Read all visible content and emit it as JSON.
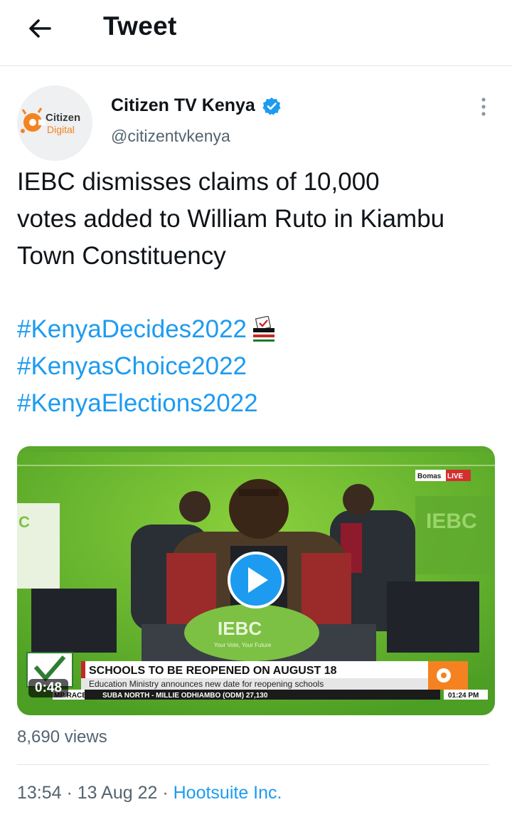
{
  "header": {
    "title": "Tweet",
    "back_icon": "arrow-left-icon"
  },
  "author": {
    "name": "Citizen TV Kenya",
    "handle": "@citizentvkenya",
    "verified": true,
    "avatar_logo_line1": "Citizen",
    "avatar_logo_line2": "Digital"
  },
  "tweet": {
    "text_lines": [
      "IEBC dismisses claims of 10,000",
      "votes added to William Ruto in Kiambu",
      "Town Constituency"
    ],
    "hashtags": [
      "#KenyaDecides2022",
      "#KenyasChoice2022",
      "#KenyaElections2022"
    ]
  },
  "video": {
    "duration": "0:48",
    "live_tag_brand": "Bomas",
    "live_tag_live": "LIVE",
    "podium_text": "IEBC",
    "podium_subtext": "Your Vote, Your Future",
    "backdrop_text": "IEBC",
    "headline": "SCHOOLS TO BE REOPENED ON AUGUST 18",
    "subheadline": "Education Ministry announces new date for reopening schools",
    "ticker_label": "MP RACE",
    "ticker_text": "SUBA NORTH - MILLIE ODHIAMBO (ODM) 27,130",
    "clock": "01:24 PM"
  },
  "stats": {
    "views": "8,690 views"
  },
  "meta": {
    "time": "13:54",
    "sep1": " · ",
    "date": "13 Aug 22",
    "sep2": " · ",
    "source": "Hootsuite Inc."
  },
  "colors": {
    "link": "#1d9bf0",
    "secondary": "#536471",
    "brand_orange": "#f58220",
    "divider": "#e1e6ea"
  }
}
